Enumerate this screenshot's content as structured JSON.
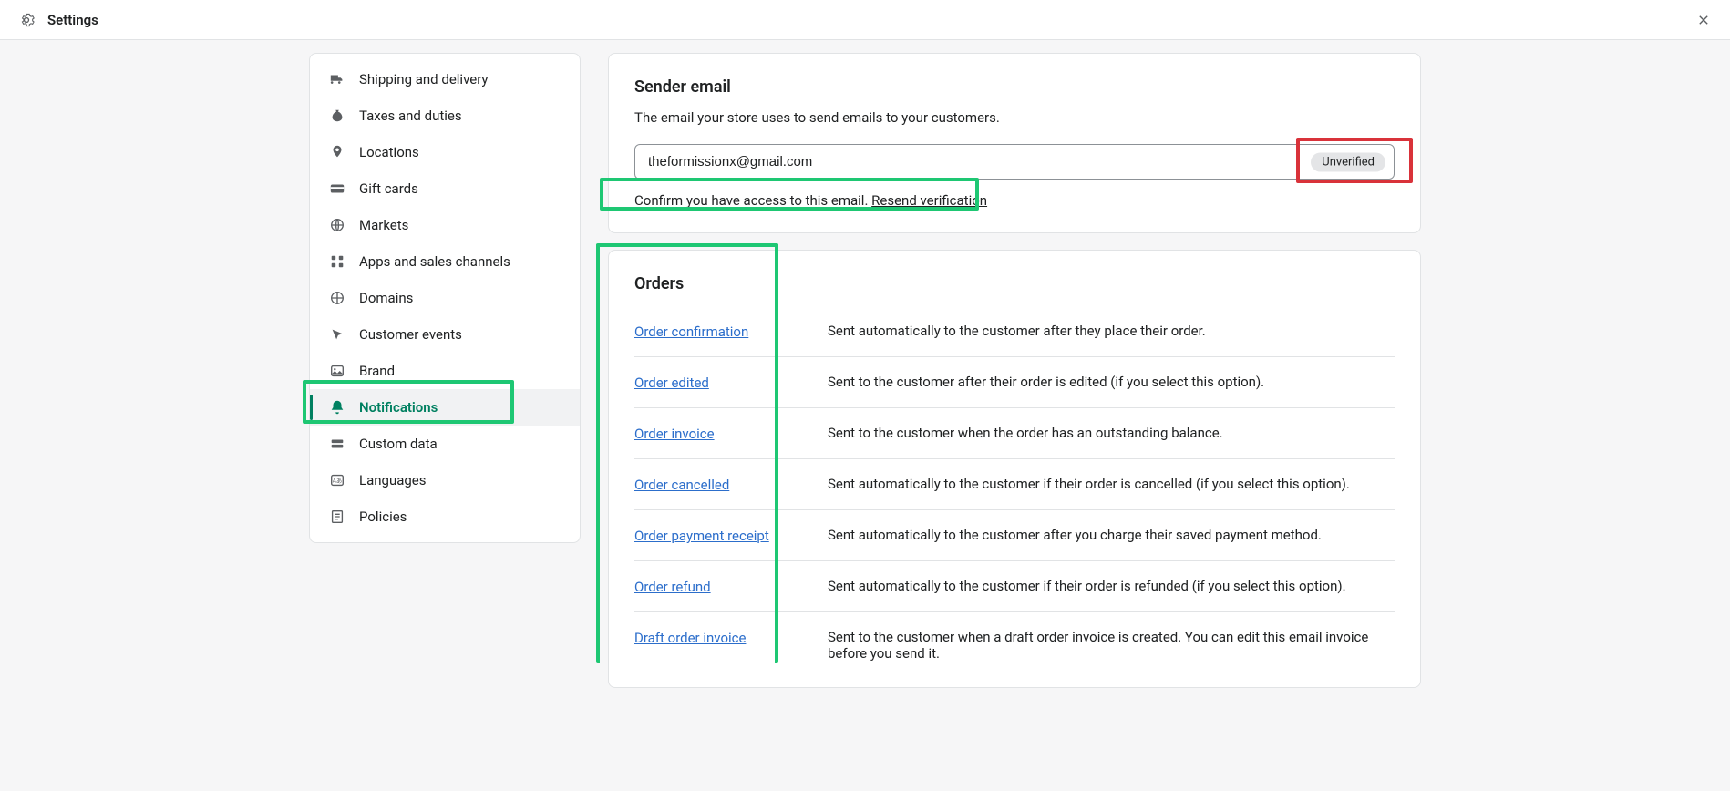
{
  "header": {
    "title": "Settings"
  },
  "sidebar": {
    "items": [
      {
        "label": "Shipping and delivery"
      },
      {
        "label": "Taxes and duties"
      },
      {
        "label": "Locations"
      },
      {
        "label": "Gift cards"
      },
      {
        "label": "Markets"
      },
      {
        "label": "Apps and sales channels"
      },
      {
        "label": "Domains"
      },
      {
        "label": "Customer events"
      },
      {
        "label": "Brand"
      },
      {
        "label": "Notifications"
      },
      {
        "label": "Custom data"
      },
      {
        "label": "Languages"
      },
      {
        "label": "Policies"
      }
    ]
  },
  "sender": {
    "heading": "Sender email",
    "description": "The email your store uses to send emails to your customers.",
    "email_value": "theformissionx@gmail.com",
    "badge": "Unverified",
    "confirm_text": "Confirm you have access to this email. ",
    "resend_text": "Resend verification"
  },
  "orders": {
    "heading": "Orders",
    "rows": [
      {
        "link": "Order confirmation",
        "desc": "Sent automatically to the customer after they place their order."
      },
      {
        "link": "Order edited",
        "desc": "Sent to the customer after their order is edited (if you select this option)."
      },
      {
        "link": "Order invoice",
        "desc": "Sent to the customer when the order has an outstanding balance."
      },
      {
        "link": "Order cancelled",
        "desc": "Sent automatically to the customer if their order is cancelled (if you select this option)."
      },
      {
        "link": "Order payment receipt",
        "desc": "Sent automatically to the customer after you charge their saved payment method."
      },
      {
        "link": "Order refund",
        "desc": "Sent automatically to the customer if their order is refunded (if you select this option)."
      },
      {
        "link": "Draft order invoice",
        "desc": "Sent to the customer when a draft order invoice is created. You can edit this email invoice before you send it."
      }
    ]
  }
}
